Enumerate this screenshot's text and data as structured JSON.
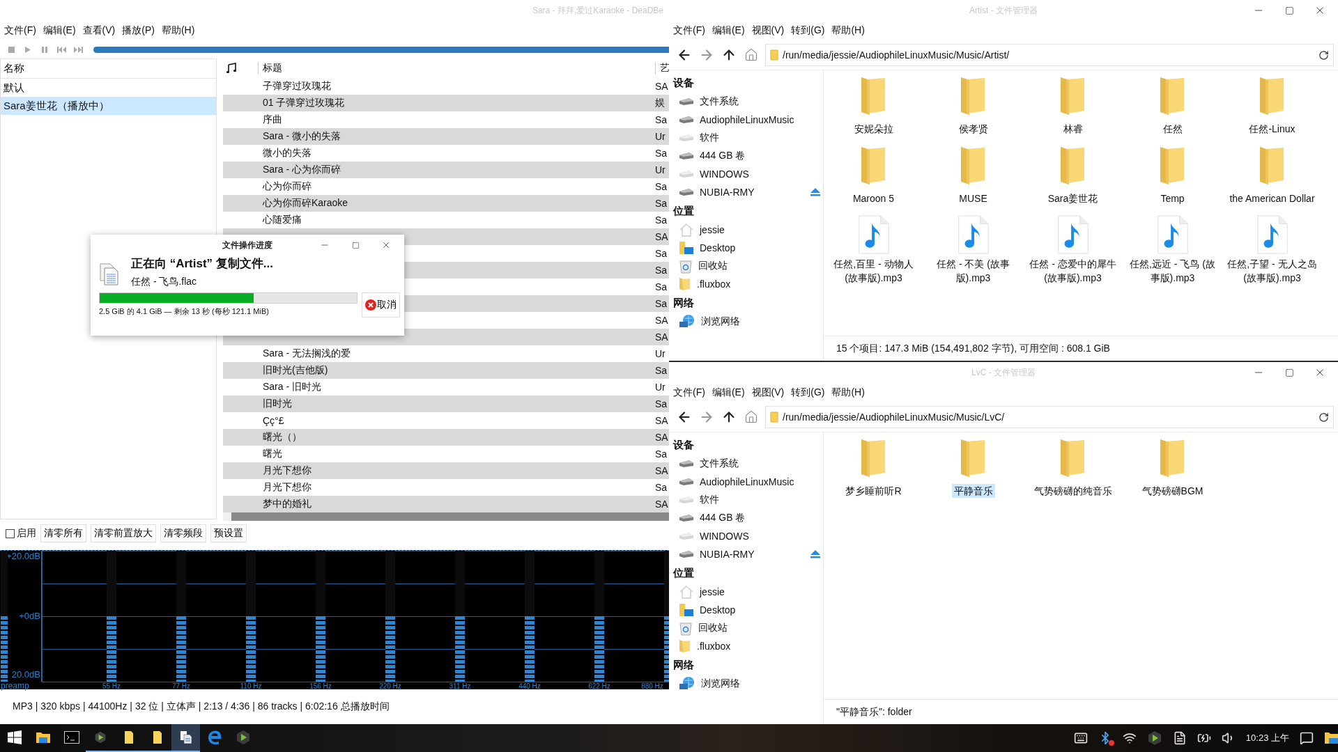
{
  "player": {
    "title": "Sara - 拜拜,爱过Karaoke - DeaDBe",
    "menu": [
      "文件(F)",
      "编辑(E)",
      "查看(V)",
      "播放(P)",
      "帮助(H)"
    ],
    "playlists": {
      "header": "名称",
      "items": [
        {
          "label": "默认",
          "selected": false
        },
        {
          "label": "Sara姜世花（播放中）",
          "selected": true
        }
      ]
    },
    "tracklist": {
      "columns": [
        "标题",
        "艺"
      ],
      "rows": [
        {
          "title": "子弹穿过玫瑰花",
          "artist": "SA"
        },
        {
          "title": "01 子弹穿过玫瑰花",
          "artist": "娱"
        },
        {
          "title": "序曲",
          "artist": "Sa"
        },
        {
          "title": "Sara - 微小的失落",
          "artist": "Ur"
        },
        {
          "title": "微小的失落",
          "artist": "Sa"
        },
        {
          "title": "Sara - 心为你而碎",
          "artist": "Ur"
        },
        {
          "title": "心为你而碎",
          "artist": "Sa"
        },
        {
          "title": "心为你而碎Karaoke",
          "artist": "Sa"
        },
        {
          "title": "心随爱痛",
          "artist": "Sa"
        },
        {
          "artist": "SA"
        },
        {
          "artist": "Sa"
        },
        {
          "artist": "Sa"
        },
        {
          "artist": "Sa"
        },
        {
          "artist": "Sa"
        },
        {
          "artist": "SA"
        },
        {
          "artist": "SA"
        },
        {
          "title": "Sara - 无法搁浅的爱",
          "artist": "Ur"
        },
        {
          "title": "旧时光(吉他版)",
          "artist": "Sa"
        },
        {
          "title": "Sara - 旧时光",
          "artist": "Ur"
        },
        {
          "title": "旧时光",
          "artist": "Sa"
        },
        {
          "title": "Çç°£",
          "artist": "SA"
        },
        {
          "title": "曙光（）",
          "artist": "SA"
        },
        {
          "title": "曙光",
          "artist": "Sa"
        },
        {
          "title": "月光下想你",
          "artist": "SA"
        },
        {
          "title": "月光下想你",
          "artist": "Sa"
        },
        {
          "title": "梦中的婚礼",
          "artist": "SA"
        }
      ]
    },
    "eq": {
      "enabled": false,
      "enable_label": "启用",
      "buttons": [
        "清零所有",
        "清零前置放大",
        "清零频段",
        "预设置"
      ],
      "scale": [
        "+20.0dB",
        "+0dB",
        "20.0dB"
      ],
      "preamp": {
        "label": "preamp",
        "level": 0.5
      },
      "bands": [
        {
          "label": "55 Hz",
          "level": 0.5
        },
        {
          "label": "77 Hz",
          "level": 0.5
        },
        {
          "label": "110 Hz",
          "level": 0.5
        },
        {
          "label": "156 Hz",
          "level": 0.5
        },
        {
          "label": "220 Hz",
          "level": 0.5
        },
        {
          "label": "311 Hz",
          "level": 0.5
        },
        {
          "label": "440 Hz",
          "level": 0.5
        },
        {
          "label": "622 Hz",
          "level": 0.5
        },
        {
          "label": "880 Hz",
          "level": 0.5
        }
      ]
    },
    "status": "MP3 | 320 kbps | 44100Hz | 32 位 | 立体声 | 2:13 / 4:36 | 86 tracks | 6:02:16 总播放时间"
  },
  "dialog": {
    "title": "文件操作进度",
    "heading": "正在向 “Artist” 复制文件...",
    "file": "任然 - 飞鸟.flac",
    "progress": {
      "level": 0.6
    },
    "detail": "2.5 GiB 的 4.1 GiB — 剩余 13 秒 (每秒 121.1 MiB)",
    "cancel": "取消"
  },
  "file_managers": [
    {
      "title": "Artist - 文件管理器",
      "menu": [
        "文件(F)",
        "编辑(E)",
        "视图(V)",
        "转到(G)",
        "帮助(H)"
      ],
      "path": "/run/media/jessie/AudiophileLinuxMusic/Music/Artist/",
      "sections": [
        {
          "title": "设备",
          "items": [
            {
              "label": "文件系统",
              "kind": "drive"
            },
            {
              "label": "AudiophileLinuxMusic",
              "kind": "drive"
            },
            {
              "label": "软件",
              "kind": "drive-unmounted"
            },
            {
              "label": "444 GB 卷",
              "kind": "drive"
            },
            {
              "label": "WINDOWS",
              "kind": "drive-unmounted"
            },
            {
              "label": "NUBIA-RMY",
              "kind": "removable"
            }
          ]
        },
        {
          "title": "位置",
          "items": [
            {
              "label": "jessie",
              "kind": "home"
            },
            {
              "label": "Desktop",
              "kind": "desktop"
            },
            {
              "label": "回收站",
              "kind": "trash"
            },
            {
              "label": ".fluxbox",
              "kind": "folder"
            }
          ]
        },
        {
          "title": "网络",
          "items": [
            {
              "label": "浏览网络",
              "kind": "network"
            }
          ]
        }
      ],
      "files": [
        {
          "name": "安妮朵拉",
          "kind": "folder",
          "selected": false
        },
        {
          "name": "侯孝贤",
          "kind": "folder",
          "selected": false
        },
        {
          "name": "林睿",
          "kind": "folder",
          "selected": false
        },
        {
          "name": "任然",
          "kind": "folder",
          "selected": false
        },
        {
          "name": "任然-Linux",
          "kind": "folder",
          "selected": false
        },
        {
          "name": "Maroon 5",
          "kind": "folder",
          "selected": false
        },
        {
          "name": "MUSE",
          "kind": "folder",
          "selected": false
        },
        {
          "name": "Sara姜世花",
          "kind": "folder",
          "selected": false
        },
        {
          "name": "Temp",
          "kind": "folder",
          "selected": false
        },
        {
          "name": "the American Dollar",
          "kind": "folder",
          "selected": false
        },
        {
          "name": "任然,百里 - 动物人 (故事版).mp3",
          "kind": "audio",
          "selected": false
        },
        {
          "name": "任然 - 不美 (故事版).mp3",
          "kind": "audio",
          "selected": false
        },
        {
          "name": "任然 - 恋爱中的犀牛 (故事版).mp3",
          "kind": "audio",
          "selected": false
        },
        {
          "name": "任然,远近 - 飞鸟 (故事版).mp3",
          "kind": "audio",
          "selected": false
        },
        {
          "name": "任然,子望 - 无人之岛 (故事版).mp3",
          "kind": "audio",
          "selected": false
        }
      ],
      "status": "15 个项目: 147.3 MiB (154,491,802 字节), 可用空间 : 608.1 GiB"
    },
    {
      "title": "LvC - 文件管理器",
      "menu": [
        "文件(F)",
        "编辑(E)",
        "视图(V)",
        "转到(G)",
        "帮助(H)"
      ],
      "path": "/run/media/jessie/AudiophileLinuxMusic/Music/LvC/",
      "sections": [
        {
          "title": "设备",
          "items": [
            {
              "label": "文件系统",
              "kind": "drive"
            },
            {
              "label": "AudiophileLinuxMusic",
              "kind": "drive"
            },
            {
              "label": "软件",
              "kind": "drive-unmounted"
            },
            {
              "label": "444 GB 卷",
              "kind": "drive"
            },
            {
              "label": "WINDOWS",
              "kind": "drive-unmounted"
            },
            {
              "label": "NUBIA-RMY",
              "kind": "removable"
            }
          ]
        },
        {
          "title": "位置",
          "items": [
            {
              "label": "jessie",
              "kind": "home"
            },
            {
              "label": "Desktop",
              "kind": "desktop"
            },
            {
              "label": "回收站",
              "kind": "trash"
            },
            {
              "label": ".fluxbox",
              "kind": "folder"
            }
          ]
        },
        {
          "title": "网络",
          "items": [
            {
              "label": "浏览网络",
              "kind": "network"
            }
          ]
        }
      ],
      "files": [
        {
          "name": "梦乡睡前听R",
          "kind": "folder",
          "selected": false
        },
        {
          "name": "平静音乐",
          "kind": "folder",
          "selected": true
        },
        {
          "name": "气势磅礴的纯音乐",
          "kind": "folder",
          "selected": false
        },
        {
          "name": "气势磅礴BGM",
          "kind": "folder",
          "selected": false
        }
      ],
      "status": "\"平静音乐\": folder"
    }
  ],
  "taskbar": {
    "apps": [
      {
        "running": false,
        "selected": false
      },
      {
        "running": false,
        "selected": false
      },
      {
        "running": false,
        "selected": false
      },
      {
        "running": true,
        "selected": false
      },
      {
        "running": true,
        "selected": false
      },
      {
        "running": true,
        "selected": false
      },
      {
        "running": true,
        "selected": true
      },
      {
        "running": false,
        "selected": false
      },
      {
        "running": false,
        "selected": false
      }
    ],
    "clock": "10:23 上午"
  }
}
